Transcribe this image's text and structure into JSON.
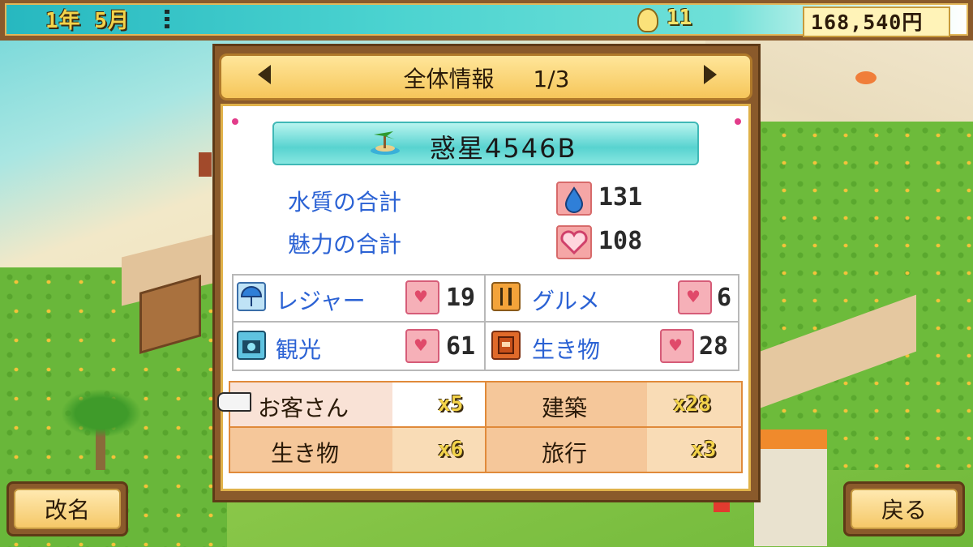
{
  "status": {
    "date": "1年 5月",
    "ideas": "11",
    "money": "168,540円",
    "icons": [
      "menu-dots-icon",
      "lightbulb-icon"
    ]
  },
  "panel": {
    "title": "全体情報",
    "page": "1/3",
    "planet_name": "惑星4546B",
    "totals": [
      {
        "label": "水質の合計",
        "value": "131",
        "icon": "water-drop-icon"
      },
      {
        "label": "魅力の合計",
        "value": "108",
        "icon": "heart-icon"
      }
    ],
    "categories": [
      {
        "label": "レジャー",
        "value": "19",
        "icon": "umbrella-icon"
      },
      {
        "label": "グルメ",
        "value": "6",
        "icon": "cutlery-icon"
      },
      {
        "label": "観光",
        "value": "61",
        "icon": "camera-icon"
      },
      {
        "label": "生き物",
        "value": "28",
        "icon": "book-icon"
      }
    ],
    "multipliers": [
      {
        "label": "お客さん",
        "value": "x5"
      },
      {
        "label": "建築",
        "value": "x28"
      },
      {
        "label": "生き物",
        "value": "x6"
      },
      {
        "label": "旅行",
        "value": "x3"
      }
    ]
  },
  "buttons": {
    "rename": "改名",
    "back": "戻る"
  },
  "colors": {
    "accent_blue": "#2b62d4",
    "frame_brown": "#8a5a2b",
    "gold": "#f3d34a"
  }
}
